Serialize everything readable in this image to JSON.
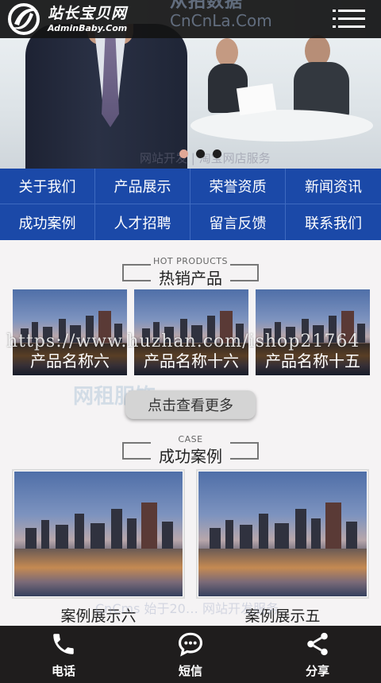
{
  "header": {
    "logo_title": "站长宝贝网",
    "logo_sub": "AdminBaby.Com",
    "watermark_line1": "从拍数据",
    "watermark_line2": "CnCnLa.Com"
  },
  "banner": {
    "watermark": "网站开发 | 淘宝网店服务"
  },
  "nav": [
    "关于我们",
    "产品展示",
    "荣誉资质",
    "新闻资讯",
    "成功案例",
    "人才招聘",
    "留言反馈",
    "联系我们"
  ],
  "hot": {
    "en": "HOT PRODUCTS",
    "cn": "热销产品"
  },
  "products": [
    "产品名称六",
    "产品名称十六",
    "产品名称十五"
  ],
  "url_watermark": "https://www.huzhan.com/ishop21764",
  "more_label": "点击查看更多",
  "bg_watermark1": "网租服饰",
  "bg_watermark2": "CnCms   始于20… 网站开发服务",
  "case": {
    "en": "CASE",
    "cn": "成功案例"
  },
  "cases": [
    "案例展示六",
    "案例展示五"
  ],
  "bottom_bar": [
    {
      "icon": "phone-icon",
      "label": "电话"
    },
    {
      "icon": "sms-icon",
      "label": "短信"
    },
    {
      "icon": "share-icon",
      "label": "分享"
    }
  ],
  "colors": {
    "nav_bg": "#1b49a8",
    "header_bg": "#141414",
    "bottom_bg": "#1f1d1d",
    "active_dot": "#e0a896"
  }
}
